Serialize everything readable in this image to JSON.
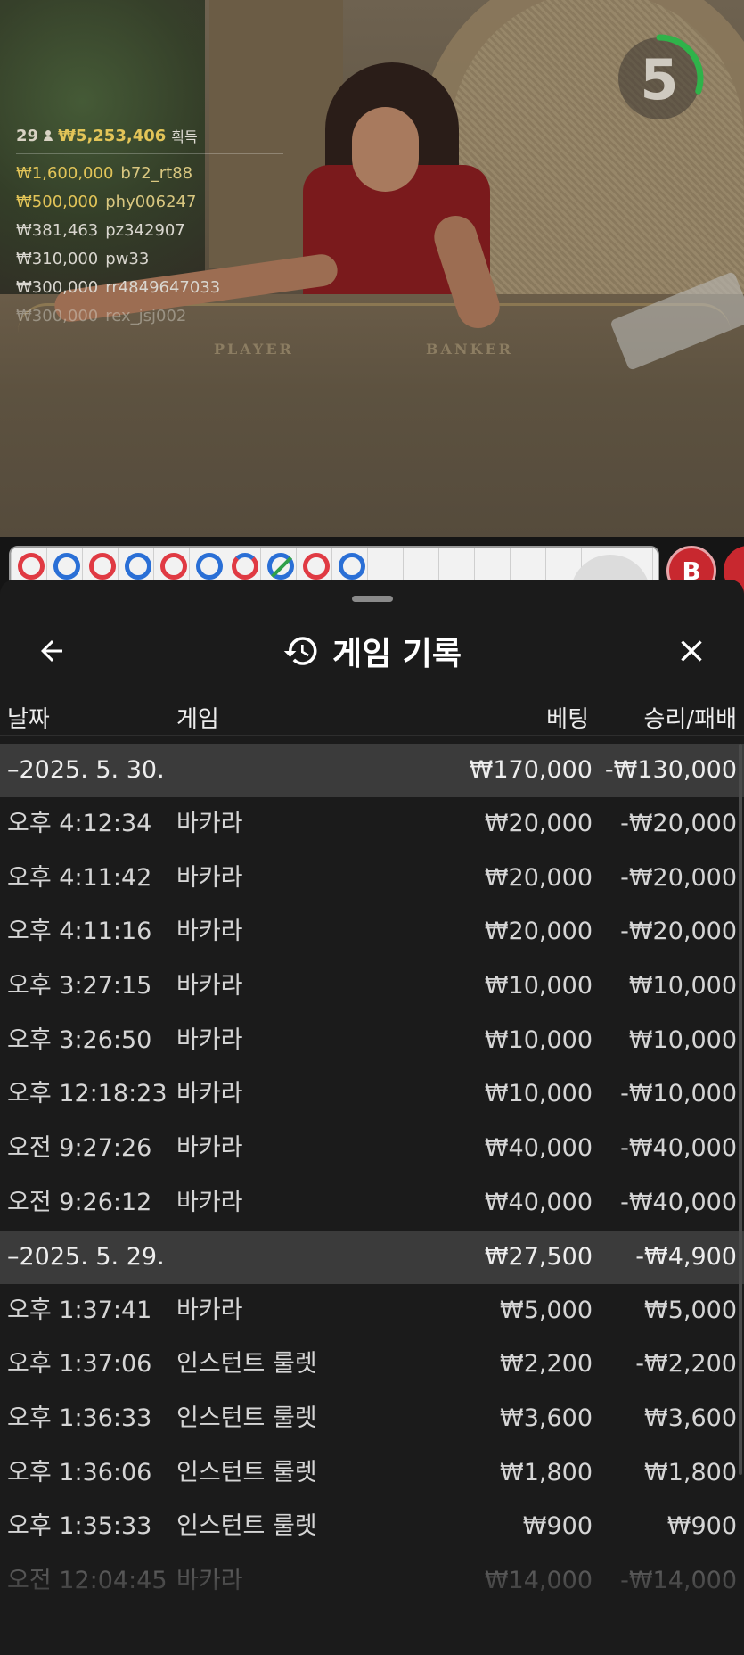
{
  "video": {
    "table_labels": [
      "PLAYER",
      "BANKER"
    ],
    "timer": "5",
    "timer_fraction_remaining": 0.3
  },
  "winners": {
    "count": "29",
    "total": "₩5,253,406",
    "suffix": "획득",
    "rows": [
      {
        "amount": "₩1,600,000",
        "user": "b72_rt88"
      },
      {
        "amount": "₩500,000",
        "user": "phy006247"
      },
      {
        "amount": "₩381,463",
        "user": "pz342907"
      },
      {
        "amount": "₩310,000",
        "user": "pw33"
      },
      {
        "amount": "₩300,000",
        "user": "rr4849647033"
      },
      {
        "amount": "₩300,000",
        "user": "rex_jsj002"
      }
    ]
  },
  "roadmap": {
    "beads": [
      "b",
      "p",
      "b",
      "p",
      "b",
      "p",
      "t-b",
      "tie-p",
      "b",
      "p"
    ],
    "bet_button": "B"
  },
  "sheet": {
    "title": "게임 기록",
    "columns": {
      "date": "날짜",
      "game": "게임",
      "bet": "베팅",
      "result": "승리/패배"
    }
  },
  "history": [
    {
      "date": "–2025. 5. 30.",
      "bet_total": "₩170,000",
      "result_total": "-₩130,000",
      "rows": [
        {
          "time": "오후 4:12:34",
          "game": "바카라",
          "bet": "₩20,000",
          "result": "-₩20,000"
        },
        {
          "time": "오후 4:11:42",
          "game": "바카라",
          "bet": "₩20,000",
          "result": "-₩20,000"
        },
        {
          "time": "오후 4:11:16",
          "game": "바카라",
          "bet": "₩20,000",
          "result": "-₩20,000"
        },
        {
          "time": "오후 3:27:15",
          "game": "바카라",
          "bet": "₩10,000",
          "result": "₩10,000"
        },
        {
          "time": "오후 3:26:50",
          "game": "바카라",
          "bet": "₩10,000",
          "result": "₩10,000"
        },
        {
          "time": "오후 12:18:23",
          "game": "바카라",
          "bet": "₩10,000",
          "result": "-₩10,000"
        },
        {
          "time": "오전 9:27:26",
          "game": "바카라",
          "bet": "₩40,000",
          "result": "-₩40,000"
        },
        {
          "time": "오전 9:26:12",
          "game": "바카라",
          "bet": "₩40,000",
          "result": "-₩40,000"
        }
      ]
    },
    {
      "date": "–2025. 5. 29.",
      "bet_total": "₩27,500",
      "result_total": "-₩4,900",
      "rows": [
        {
          "time": "오후 1:37:41",
          "game": "바카라",
          "bet": "₩5,000",
          "result": "₩5,000"
        },
        {
          "time": "오후 1:37:06",
          "game": "인스턴트 룰렛",
          "bet": "₩2,200",
          "result": "-₩2,200"
        },
        {
          "time": "오후 1:36:33",
          "game": "인스턴트 룰렛",
          "bet": "₩3,600",
          "result": "₩3,600"
        },
        {
          "time": "오후 1:36:06",
          "game": "인스턴트 룰렛",
          "bet": "₩1,800",
          "result": "₩1,800"
        },
        {
          "time": "오후 1:35:33",
          "game": "인스턴트 룰렛",
          "bet": "₩900",
          "result": "₩900"
        },
        {
          "time": "오전 12:04:45",
          "game": "바카라",
          "bet": "₩14,000",
          "result": "-₩14,000"
        }
      ]
    }
  ]
}
